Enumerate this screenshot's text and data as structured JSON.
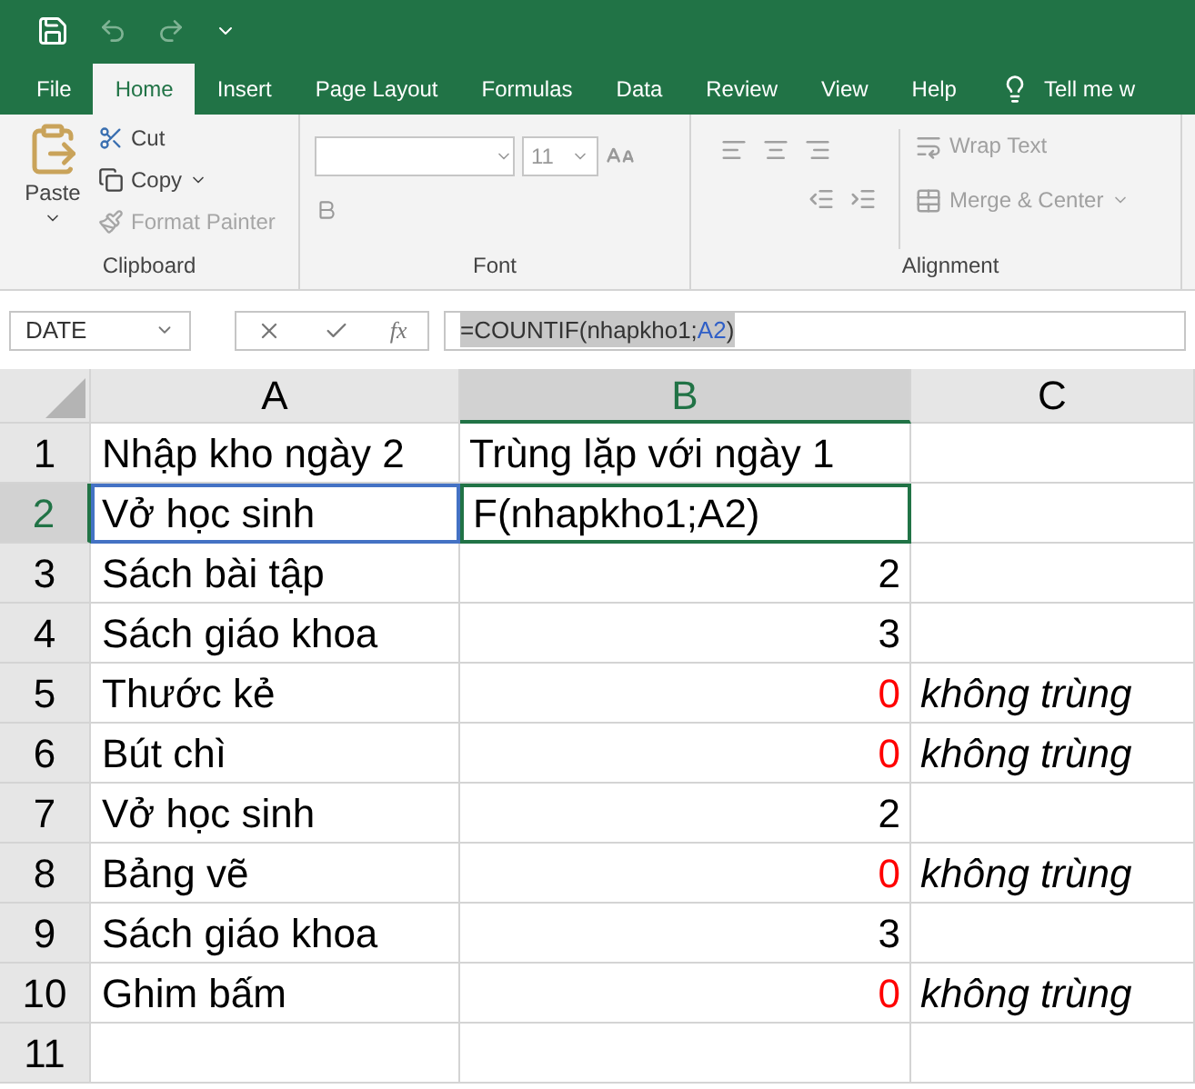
{
  "tabs": [
    {
      "label": "File",
      "selected": false
    },
    {
      "label": "Home",
      "selected": true
    },
    {
      "label": "Insert",
      "selected": false
    },
    {
      "label": "Page Layout",
      "selected": false
    },
    {
      "label": "Formulas",
      "selected": false
    },
    {
      "label": "Data",
      "selected": false
    },
    {
      "label": "Review",
      "selected": false
    },
    {
      "label": "View",
      "selected": false
    },
    {
      "label": "Help",
      "selected": false
    }
  ],
  "tell_me": "Tell me w",
  "clipboard": {
    "paste": "Paste",
    "cut": "Cut",
    "copy": "Copy",
    "format_painter": "Format Painter",
    "format_painter_disabled": true,
    "label": "Clipboard"
  },
  "font": {
    "size": "11",
    "label": "Font"
  },
  "alignment": {
    "wrap_text": "Wrap Text",
    "merge_center": "Merge & Center",
    "label": "Alignment"
  },
  "name_box": "DATE",
  "insert_function": "fx",
  "formula_parts": [
    {
      "text": "=COUNTIF(nhapkho1;",
      "kind": "plain"
    },
    {
      "text": "A2",
      "kind": "ref"
    },
    {
      "text": ")",
      "kind": "plain"
    }
  ],
  "columns": [
    {
      "label": "A",
      "selected": false
    },
    {
      "label": "B",
      "selected": true
    },
    {
      "label": "C",
      "selected": false
    }
  ],
  "rows": [
    {
      "number": "1",
      "selected": false,
      "a": {
        "text": "Nhập kho ngày 2",
        "referenced": false
      },
      "b": {
        "text": "Trùng lặp với ngày 1",
        "kind": "text",
        "red": false
      }
    },
    {
      "number": "2",
      "selected": true,
      "a": {
        "text": "Vở học sinh",
        "referenced": true
      },
      "b": {
        "text": "F(nhapkho1;A2)",
        "kind": "editing",
        "red": false
      }
    },
    {
      "number": "3",
      "selected": false,
      "a": {
        "text": "Sách bài tập",
        "referenced": false
      },
      "b": {
        "text": "2",
        "kind": "number",
        "red": false
      }
    },
    {
      "number": "4",
      "selected": false,
      "a": {
        "text": "Sách giáo khoa",
        "referenced": false
      },
      "b": {
        "text": "3",
        "kind": "number",
        "red": false
      }
    },
    {
      "number": "5",
      "selected": false,
      "a": {
        "text": "Thước kẻ",
        "referenced": false
      },
      "b": {
        "text": "0",
        "kind": "number",
        "red": true
      },
      "c": "không trùng"
    },
    {
      "number": "6",
      "selected": false,
      "a": {
        "text": "Bút chì",
        "referenced": false
      },
      "b": {
        "text": "0",
        "kind": "number",
        "red": true
      },
      "c": "không trùng"
    },
    {
      "number": "7",
      "selected": false,
      "a": {
        "text": "Vở học sinh",
        "referenced": false
      },
      "b": {
        "text": "2",
        "kind": "number",
        "red": false
      }
    },
    {
      "number": "8",
      "selected": false,
      "a": {
        "text": "Bảng vẽ",
        "referenced": false
      },
      "b": {
        "text": "0",
        "kind": "number",
        "red": true
      },
      "c": "không trùng"
    },
    {
      "number": "9",
      "selected": false,
      "a": {
        "text": "Sách giáo khoa",
        "referenced": false
      },
      "b": {
        "text": "3",
        "kind": "number",
        "red": false
      }
    },
    {
      "number": "10",
      "selected": false,
      "a": {
        "text": "Ghim bấm",
        "referenced": false
      },
      "b": {
        "text": "0",
        "kind": "number",
        "red": true
      },
      "c": "không trùng"
    },
    {
      "number": "11",
      "selected": false
    }
  ]
}
